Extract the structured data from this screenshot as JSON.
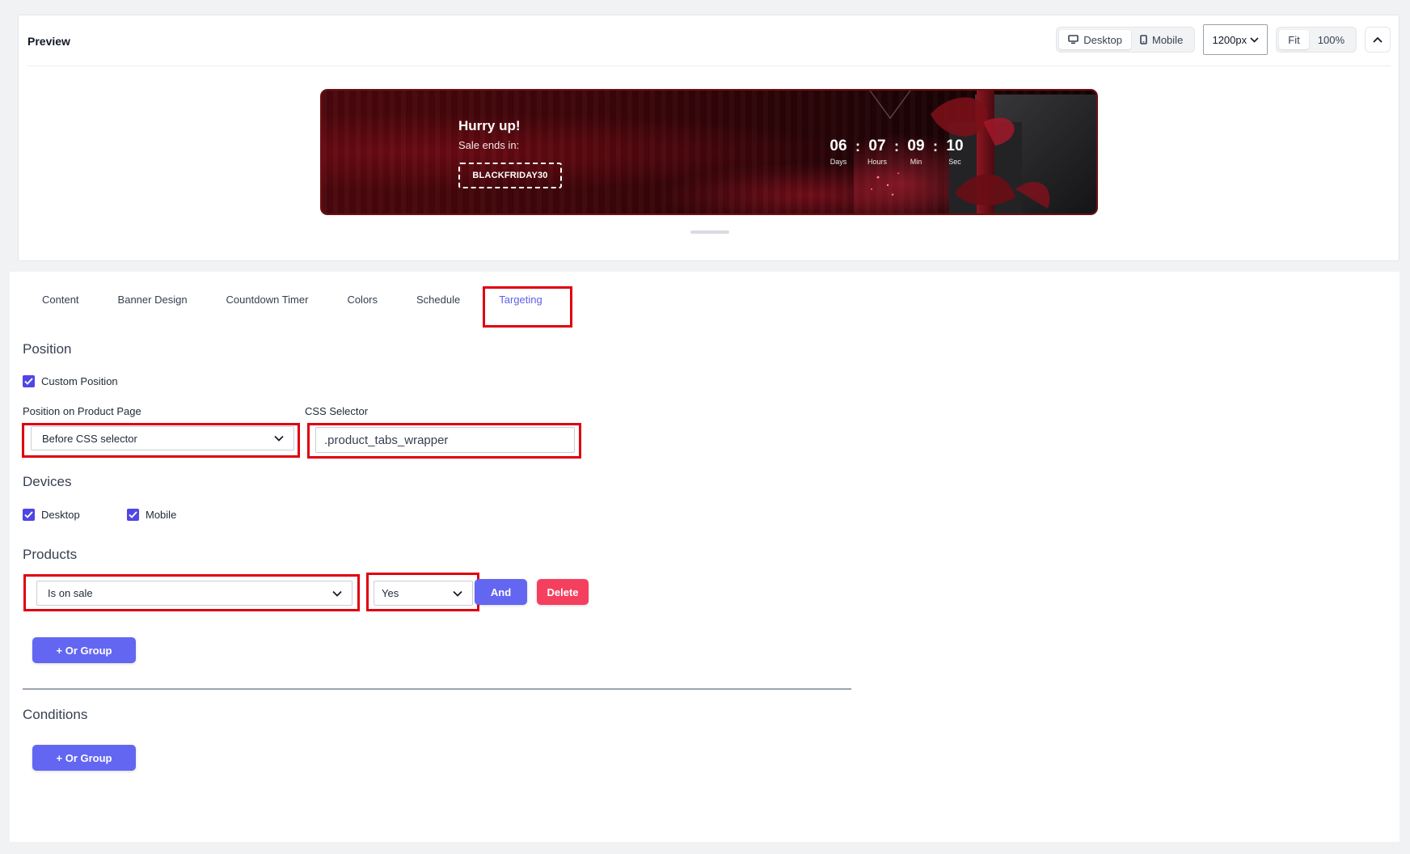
{
  "preview": {
    "title": "Preview",
    "device_toggle": {
      "desktop_label": "Desktop",
      "mobile_label": "Mobile",
      "active": "Desktop"
    },
    "width_select": "1200px",
    "zoom": {
      "fit_label": "Fit",
      "percent_label": "100%"
    }
  },
  "banner": {
    "headline": "Hurry up!",
    "subtext": "Sale ends in:",
    "coupon_code": "BLACKFRIDAY30",
    "countdown": {
      "days": "06",
      "hours": "07",
      "minutes": "09",
      "seconds": "10",
      "days_label": "Days",
      "hours_label": "Hours",
      "minutes_label": "Min",
      "seconds_label": "Sec",
      "separator": ":"
    }
  },
  "tabs": [
    {
      "label": "Content"
    },
    {
      "label": "Banner Design"
    },
    {
      "label": "Countdown Timer"
    },
    {
      "label": "Colors"
    },
    {
      "label": "Schedule"
    },
    {
      "label": "Targeting",
      "active": true
    }
  ],
  "position": {
    "title": "Position",
    "custom_position_label": "Custom Position",
    "custom_position_checked": true,
    "product_page_label": "Position on Product Page",
    "product_page_value": "Before CSS selector",
    "css_selector_label": "CSS Selector",
    "css_selector_value": ".product_tabs_wrapper"
  },
  "devices": {
    "title": "Devices",
    "desktop_label": "Desktop",
    "desktop_checked": true,
    "mobile_label": "Mobile",
    "mobile_checked": true
  },
  "products": {
    "title": "Products",
    "rule_field_value": "Is on sale",
    "rule_value": "Yes",
    "and_label": "And",
    "delete_label": "Delete",
    "or_group_label": "+ Or Group"
  },
  "conditions": {
    "title": "Conditions",
    "or_group_label": "+ Or Group"
  },
  "colors": {
    "accent": "#6366f1",
    "danger": "#f43f5e",
    "highlight": "#e0000f",
    "checkbox": "#4f46e5"
  }
}
